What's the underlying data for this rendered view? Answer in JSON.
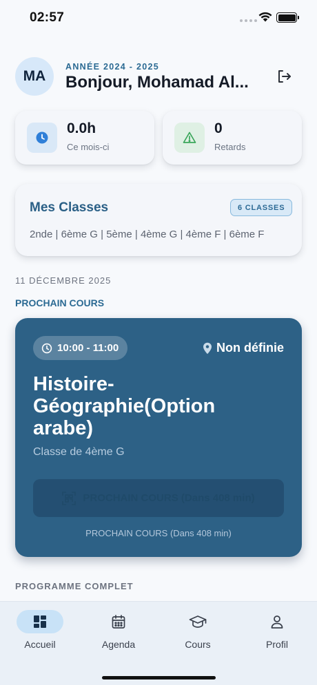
{
  "status_bar": {
    "time": "02:57"
  },
  "header": {
    "avatar_initials": "MA",
    "year_label": "ANNÉE 2024 - 2025",
    "greeting": "Bonjour, Mohamad Al..."
  },
  "stats": {
    "hours": {
      "value": "0.0h",
      "label": "Ce mois-ci",
      "icon": "clock-icon",
      "color": "#2f7fd8"
    },
    "delays": {
      "value": "0",
      "label": "Retards",
      "icon": "warning-icon",
      "color": "#3aa65a"
    }
  },
  "classes": {
    "title": "Mes Classes",
    "badge": "6 CLASSES",
    "list": "2nde | 6ème G | 5ème | 4ème G | 4ème F | 6ème F"
  },
  "date_label": "11 DÉCEMBRE 2025",
  "next_label": "PROCHAIN COURS",
  "course": {
    "time": "10:00 - 11:00",
    "location": "Non définie",
    "title": "Histoire-Géographie(Option arabe)",
    "class": "Classe de 4ème G",
    "button_label": "PROCHAIN COURS (Dans 408 min)",
    "note": "PROCHAIN COURS (Dans 408 min)",
    "accent": "#2d6186"
  },
  "program_label": "PROGRAMME COMPLET",
  "nav": {
    "items": [
      {
        "label": "Accueil",
        "icon": "dashboard-icon",
        "active": true
      },
      {
        "label": "Agenda",
        "icon": "calendar-icon",
        "active": false
      },
      {
        "label": "Cours",
        "icon": "graduation-cap-icon",
        "active": false
      },
      {
        "label": "Profil",
        "icon": "person-icon",
        "active": false
      }
    ]
  }
}
